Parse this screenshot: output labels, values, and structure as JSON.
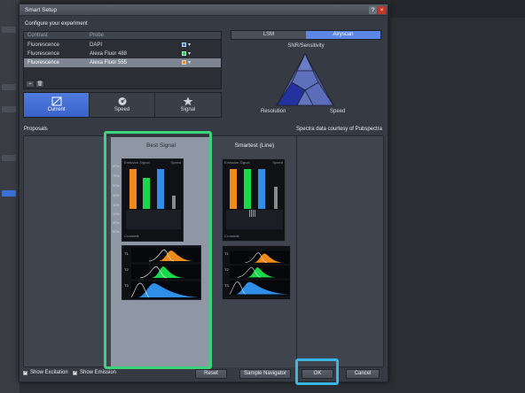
{
  "dialog": {
    "title": "Smart Setup",
    "help_label": "?",
    "close_label": "×",
    "configure_label": "Configure your experiment"
  },
  "table": {
    "headers": [
      "Contrast",
      "Probe"
    ],
    "rows": [
      {
        "contrast": "Fluorescence",
        "probe": "DAPI",
        "color": "#2f7fe0",
        "selected": false
      },
      {
        "contrast": "Fluorescence",
        "probe": "Alexa Fluor 488",
        "color": "#19d84a",
        "selected": false
      },
      {
        "contrast": "Fluorescence",
        "probe": "Alexa Fluor 555",
        "color": "#f08a1a",
        "selected": true
      }
    ],
    "add_label": "+",
    "remove_label": "🗑"
  },
  "modes": [
    {
      "label": "Current",
      "icon": "current-icon",
      "active": true
    },
    {
      "label": "Speed",
      "icon": "speed-dial-icon",
      "active": false
    },
    {
      "label": "Signal",
      "icon": "star-icon",
      "active": false
    }
  ],
  "detector": {
    "options": [
      "LSM",
      "Airyscan"
    ],
    "selected": "Airyscan"
  },
  "triangle": {
    "title": "SNR/Sensitivity",
    "left_label": "Resolution",
    "right_label": "Speed"
  },
  "proposals": {
    "label": "Proposals",
    "credit": "Spectra data courtesy of Pubspectra",
    "columns": [
      {
        "title": "Best Signal",
        "emission_label": "Emission Signal",
        "speed_label": "Speed",
        "crosstalk_label": "Crosstalk",
        "y_ticks": [
          "90%",
          "70%",
          "50%",
          "30%",
          "10%",
          "10%",
          "30%",
          "50%"
        ],
        "tracks": [
          "T1",
          "T2",
          "T3"
        ]
      },
      {
        "title": "Smartest (Line)",
        "emission_label": "Emission Signal",
        "speed_label": "Speed",
        "crosstalk_label": "Crosstalk",
        "tracks": [
          "T1",
          "T2",
          "T3"
        ]
      }
    ]
  },
  "chart_data": [
    {
      "type": "bar",
      "title": "Best Signal",
      "categories": [
        "Alexa Fluor 555",
        "Alexa Fluor 488",
        "DAPI",
        "Speed"
      ],
      "values": [
        90,
        70,
        90,
        30
      ],
      "colors": [
        "#f08a1a",
        "#19d84a",
        "#2f8ee8",
        "#8a8a8a"
      ],
      "ylabel": "Emission Signal"
    },
    {
      "type": "bar",
      "title": "Smartest (Line)",
      "categories": [
        "Alexa Fluor 555",
        "Alexa Fluor 488",
        "DAPI",
        "Speed"
      ],
      "values": [
        90,
        90,
        90,
        50
      ],
      "colors": [
        "#f08a1a",
        "#19d84a",
        "#2f8ee8",
        "#8a8a8a"
      ],
      "ylabel": "Emission Signal"
    }
  ],
  "bottom": {
    "show_excitation": "Show Excitation",
    "show_emission": "Show Emission",
    "reset": "Reset",
    "sample_navigator": "Sample Navigator",
    "ok": "OK",
    "cancel": "Cancel"
  }
}
